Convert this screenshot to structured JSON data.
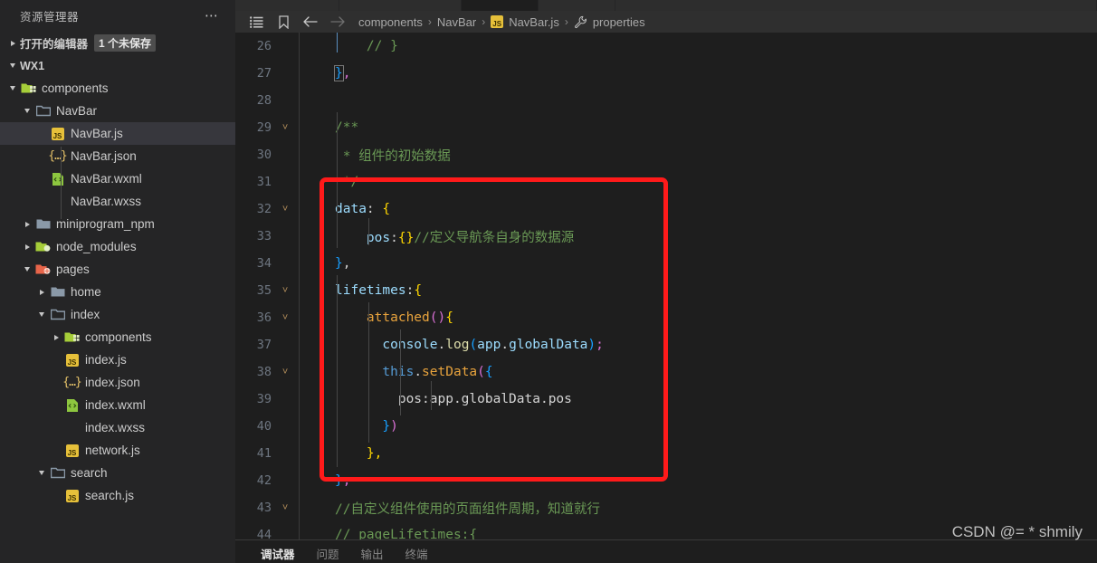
{
  "sidebar": {
    "title": "资源管理器",
    "more_icon": "ellipsis-icon",
    "open_editors": {
      "label": "打开的编辑器",
      "badge": "1 个未保存"
    },
    "workspace": "WX1",
    "items": [
      {
        "label": "components",
        "icon": "folder-components-open-icon",
        "depth": 1,
        "twisty": "down",
        "selected": false
      },
      {
        "label": "NavBar",
        "icon": "folder-open-icon",
        "depth": 2,
        "twisty": "down",
        "selected": false
      },
      {
        "label": "NavBar.js",
        "icon": "js-icon",
        "depth": 3,
        "twisty": "none",
        "selected": true
      },
      {
        "label": "NavBar.json",
        "icon": "json-icon",
        "depth": 3,
        "twisty": "none",
        "selected": false
      },
      {
        "label": "NavBar.wxml",
        "icon": "wxml-icon",
        "depth": 3,
        "twisty": "none",
        "selected": false
      },
      {
        "label": "NavBar.wxss",
        "icon": "wxss-icon",
        "depth": 3,
        "twisty": "none",
        "selected": false
      },
      {
        "label": "miniprogram_npm",
        "icon": "folder-icon",
        "depth": 2,
        "twisty": "right",
        "selected": false
      },
      {
        "label": "node_modules",
        "icon": "folder-node-icon",
        "depth": 2,
        "twisty": "right",
        "selected": false
      },
      {
        "label": "pages",
        "icon": "folder-pages-open-icon",
        "depth": 2,
        "twisty": "down",
        "selected": false
      },
      {
        "label": "home",
        "icon": "folder-icon",
        "depth": 3,
        "twisty": "right",
        "selected": false
      },
      {
        "label": "index",
        "icon": "folder-open-icon",
        "depth": 3,
        "twisty": "down",
        "selected": false
      },
      {
        "label": "components",
        "icon": "folder-components-icon",
        "depth": 4,
        "twisty": "right",
        "selected": false
      },
      {
        "label": "index.js",
        "icon": "js-icon",
        "depth": 4,
        "twisty": "none",
        "selected": false
      },
      {
        "label": "index.json",
        "icon": "json-icon",
        "depth": 4,
        "twisty": "none",
        "selected": false
      },
      {
        "label": "index.wxml",
        "icon": "wxml-icon",
        "depth": 4,
        "twisty": "none",
        "selected": false
      },
      {
        "label": "index.wxss",
        "icon": "wxss-icon",
        "depth": 4,
        "twisty": "none",
        "selected": false
      },
      {
        "label": "network.js",
        "icon": "js-icon",
        "depth": 4,
        "twisty": "none",
        "selected": false
      },
      {
        "label": "search",
        "icon": "folder-open-icon",
        "depth": 3,
        "twisty": "down",
        "selected": false
      },
      {
        "label": "search.js",
        "icon": "js-icon",
        "depth": 4,
        "twisty": "none",
        "selected": false
      }
    ]
  },
  "breadcrumb": {
    "icons": [
      "outline-icon",
      "bookmark-icon",
      "back-arrow-icon",
      "forward-arrow-icon"
    ],
    "path": [
      {
        "label": "components",
        "icon": "none"
      },
      {
        "label": "NavBar",
        "icon": "none"
      },
      {
        "label": "NavBar.js",
        "icon": "js-icon"
      },
      {
        "label": "properties",
        "icon": "wrench-icon"
      }
    ],
    "separator": "›"
  },
  "editor": {
    "file": "NavBar.js",
    "first_line": 26,
    "lines": [
      {
        "n": 26,
        "fold": false
      },
      {
        "n": 27,
        "fold": false
      },
      {
        "n": 28,
        "fold": false
      },
      {
        "n": 29,
        "fold": true
      },
      {
        "n": 30,
        "fold": false
      },
      {
        "n": 31,
        "fold": false
      },
      {
        "n": 32,
        "fold": true
      },
      {
        "n": 33,
        "fold": false
      },
      {
        "n": 34,
        "fold": false
      },
      {
        "n": 35,
        "fold": true
      },
      {
        "n": 36,
        "fold": true
      },
      {
        "n": 37,
        "fold": false
      },
      {
        "n": 38,
        "fold": true
      },
      {
        "n": 39,
        "fold": false
      },
      {
        "n": 40,
        "fold": false
      },
      {
        "n": 41,
        "fold": false
      },
      {
        "n": 42,
        "fold": false
      },
      {
        "n": 43,
        "fold": true
      },
      {
        "n": 44,
        "fold": false
      }
    ],
    "text": {
      "l26": "    // }",
      "l27": "},",
      "l28": "",
      "l29": "/**",
      "l30": " * 组件的初始数据",
      "l31": " */",
      "l32": "data: {",
      "l33": "    pos:{}//定义导航条自身的数据源",
      "l34": "},",
      "l35": "lifetimes:{",
      "l36": "    attached(){",
      "l37": "      console.log(app.globalData);",
      "l38": "      this.setData({",
      "l39": "        pos:app.globalData.pos",
      "l40": "      })",
      "l41": "    },",
      "l42": "},",
      "l43": "//自定义组件使用的页面组件周期，知道就行",
      "l44": "// pageLifetimes:{"
    }
  },
  "annotation": {
    "shape": "rectangle",
    "color": "#ff1a1a",
    "covers_lines": "32-42"
  },
  "panel": {
    "tabs": [
      {
        "label": "调试器",
        "active": true
      },
      {
        "label": "问题",
        "active": false
      },
      {
        "label": "输出",
        "active": false
      },
      {
        "label": "终端",
        "active": false
      }
    ]
  },
  "watermark": "CSDN @= * shmily"
}
